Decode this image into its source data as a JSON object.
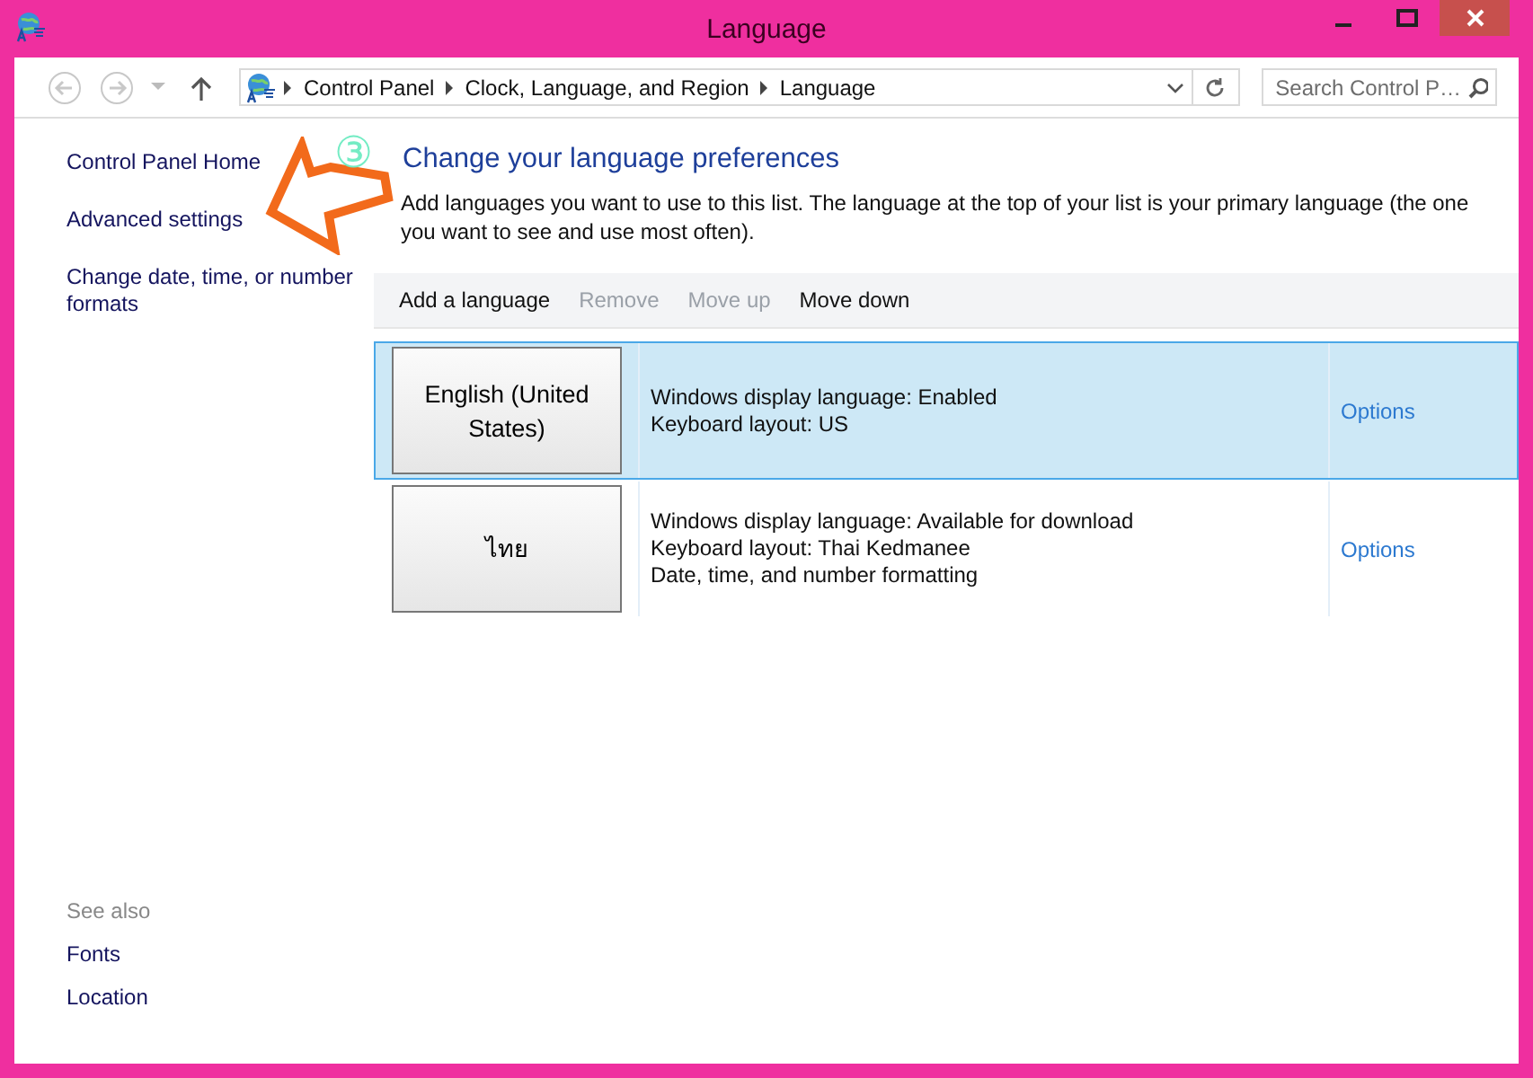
{
  "window": {
    "title": "Language"
  },
  "address_bar": {
    "breadcrumbs": [
      "Control Panel",
      "Clock, Language, and Region",
      "Language"
    ],
    "search": {
      "placeholder": "Search Control P…"
    }
  },
  "sidebar": {
    "links": [
      "Control Panel Home",
      "Advanced settings",
      "Change date, time, or number formats"
    ],
    "see_also": {
      "title": "See also",
      "links": [
        "Fonts",
        "Location"
      ]
    }
  },
  "main": {
    "heading": "Change your language preferences",
    "description": "Add languages you want to use to this list. The language at the top of your list is your primary language (the one you want to see and use most often)."
  },
  "toolbar": [
    {
      "label": "Add a language",
      "disabled": false
    },
    {
      "label": "Remove",
      "disabled": true
    },
    {
      "label": "Move up",
      "disabled": true
    },
    {
      "label": "Move down",
      "disabled": false
    }
  ],
  "languages": [
    {
      "name": "English (United States)",
      "selected": true,
      "details": [
        "Windows display language: Enabled",
        "Keyboard layout: US"
      ],
      "options": "Options"
    },
    {
      "name": "ไทย",
      "selected": false,
      "details": [
        "Windows display language: Available for download",
        "Keyboard layout: Thai Kedmanee",
        "Date, time, and number formatting"
      ],
      "options": "Options"
    }
  ],
  "annotation": {
    "label": "③"
  }
}
